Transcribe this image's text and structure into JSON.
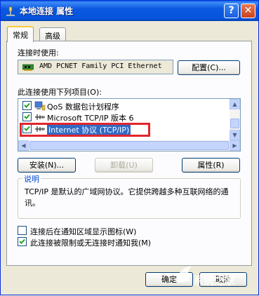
{
  "window": {
    "title": "本地连接 属性",
    "help_button": "?",
    "close_button": "✕"
  },
  "tabs": [
    "常规",
    "高级"
  ],
  "connection": {
    "label": "连接时使用:",
    "adapter": "AMD PCNET Family PCI Ethernet",
    "configure_button": "配置(C)..."
  },
  "items": {
    "label": "此连接使用下列项目(O):",
    "list": [
      {
        "label": "QoS 数据包计划程序",
        "checked": true,
        "icon": "qos-icon"
      },
      {
        "label": "Microsoft TCP/IP 版本 6",
        "checked": true,
        "icon": "protocol-icon"
      },
      {
        "label": "Internet 协议 (TCP/IP)",
        "checked": true,
        "icon": "protocol-icon",
        "selected": true
      }
    ]
  },
  "buttons": {
    "install": "安装(N)...",
    "uninstall": "卸载(U)",
    "properties": "属性(R)",
    "ok": "确定",
    "cancel": "取消"
  },
  "description": {
    "title": "说明",
    "text": "TCP/IP 是默认的广域网协议。它提供跨越多种互联网络的通讯。"
  },
  "options": [
    {
      "label": "连接后在通知区域显示图标(W)",
      "checked": false
    },
    {
      "label": "此连接被限制或无连接时通知我(M)",
      "checked": true
    }
  ],
  "watermark": "系统之家",
  "colors": {
    "titlebar": "#0b58e1",
    "highlight_border": "#e1262b",
    "selection": "#316ac5"
  }
}
